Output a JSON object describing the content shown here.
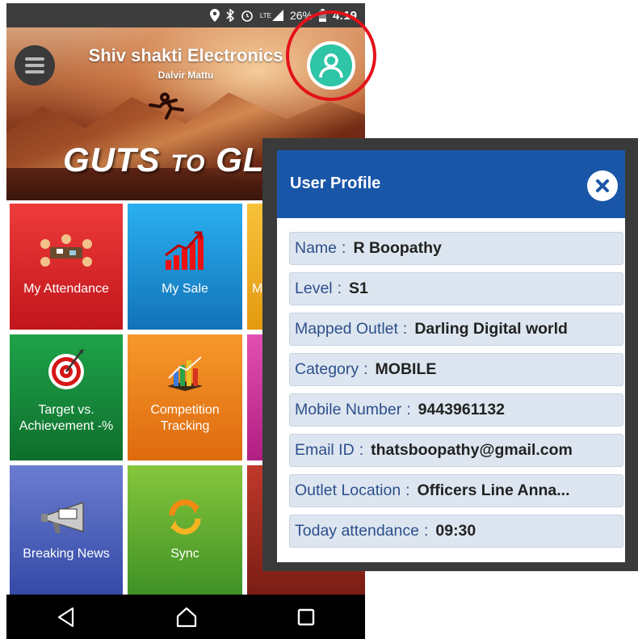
{
  "status_bar": {
    "battery": "26%",
    "network": "LTE",
    "time": "4:19"
  },
  "header": {
    "title": "Shiv shakti Electronics",
    "subtitle": "Dalvir Mattu",
    "banner_main": "GUTS",
    "banner_to": "TO",
    "banner_end": "GLO"
  },
  "tiles": [
    {
      "label": "My Attendance"
    },
    {
      "label": "My Sale"
    },
    {
      "label": "M"
    },
    {
      "label": "Target vs. Achievement -%"
    },
    {
      "label": "Competition Tracking"
    },
    {
      "label": ""
    },
    {
      "label": "Breaking News"
    },
    {
      "label": "Sync"
    },
    {
      "label": ""
    }
  ],
  "dialog": {
    "title": "User Profile",
    "fields": [
      {
        "label": "Name",
        "value": "R Boopathy"
      },
      {
        "label": "Level",
        "value": "S1"
      },
      {
        "label": "Mapped Outlet",
        "value": "Darling Digital world"
      },
      {
        "label": "Category",
        "value": "MOBILE"
      },
      {
        "label": "Mobile Number",
        "value": "9443961132"
      },
      {
        "label": "Email ID",
        "value": "thatsboopathy@gmail.com"
      },
      {
        "label": "Outlet Location",
        "value": "Officers Line Anna..."
      },
      {
        "label": "Today attendance",
        "value": "09:30"
      }
    ]
  },
  "colors": {
    "dialog_header": "#1a56a8",
    "avatar": "#2ec4a6",
    "highlight_circle": "#e4121a"
  }
}
